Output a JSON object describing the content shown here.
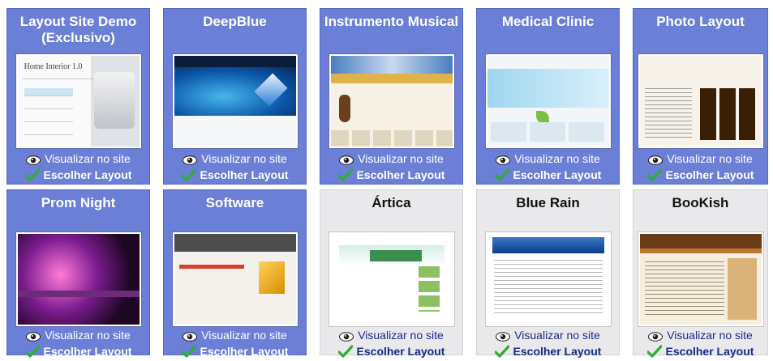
{
  "gallery": {
    "cards": [
      {
        "title": "Layout Site Demo (Exclusivo)",
        "view_label": "Visualizar no site",
        "choose_label": "Escolher Layout",
        "style": "blue",
        "thumb": "home"
      },
      {
        "title": "DeepBlue",
        "view_label": "Visualizar no site",
        "choose_label": "Escolher Layout",
        "style": "blue",
        "thumb": "deepblue"
      },
      {
        "title": "Instrumento Musical",
        "view_label": "Visualizar no site",
        "choose_label": "Escolher Layout",
        "style": "blue",
        "thumb": "music"
      },
      {
        "title": "Medical Clinic",
        "view_label": "Visualizar no site",
        "choose_label": "Escolher Layout",
        "style": "blue",
        "thumb": "clinic"
      },
      {
        "title": "Photo Layout",
        "view_label": "Visualizar no site",
        "choose_label": "Escolher Layout",
        "style": "blue",
        "thumb": "photo"
      },
      {
        "title": "Prom Night",
        "view_label": "Visualizar no site",
        "choose_label": "Escolher Layout",
        "style": "blue",
        "thumb": "prom"
      },
      {
        "title": "Software",
        "view_label": "Visualizar no site",
        "choose_label": "Escolher Layout",
        "style": "blue",
        "thumb": "soft"
      },
      {
        "title": "Ártica",
        "view_label": "Visualizar no site",
        "choose_label": "Escolher Layout",
        "style": "grey",
        "thumb": "artica"
      },
      {
        "title": "Blue Rain",
        "view_label": "Visualizar no site",
        "choose_label": "Escolher Layout",
        "style": "grey",
        "thumb": "bluerain"
      },
      {
        "title": "BooKish",
        "view_label": "Visualizar no site",
        "choose_label": "Escolher Layout",
        "style": "grey",
        "thumb": "bookish"
      }
    ]
  },
  "thumb_text": {
    "home_title": "Home Interior 1.0"
  },
  "icons": {
    "view": "eye-icon",
    "choose": "check-icon"
  },
  "colors": {
    "card_blue": "#6c7fd6",
    "card_grey": "#e9e9ec",
    "check_green": "#2fae2f",
    "link_dark_blue": "#1a2a8a"
  }
}
